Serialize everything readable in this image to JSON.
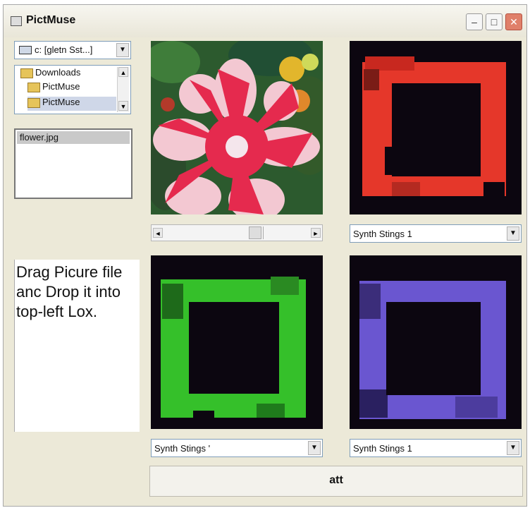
{
  "window": {
    "title": "PictMuse"
  },
  "drive": {
    "label": "c: [gletn Sst...]"
  },
  "folders": [
    {
      "label": "Downloads"
    },
    {
      "label": "PictMuse"
    },
    {
      "label": "PictMuse",
      "selected": true
    }
  ],
  "files": [
    {
      "label": "flower.jpg",
      "selected": true
    }
  ],
  "instructions": "Drag Picure file anc Drop it into top-left Lox.",
  "voices": {
    "top_right": "Synth Stings 1",
    "bottom_left": "Synth Stings '",
    "bottom_right": "Synth Stings 1"
  },
  "go_button": "att",
  "colors": {
    "red_channel": "#e5372a",
    "green_channel": "#35c02a",
    "blue_channel": "#6a56d0",
    "dark_bg": "#0c0610"
  }
}
